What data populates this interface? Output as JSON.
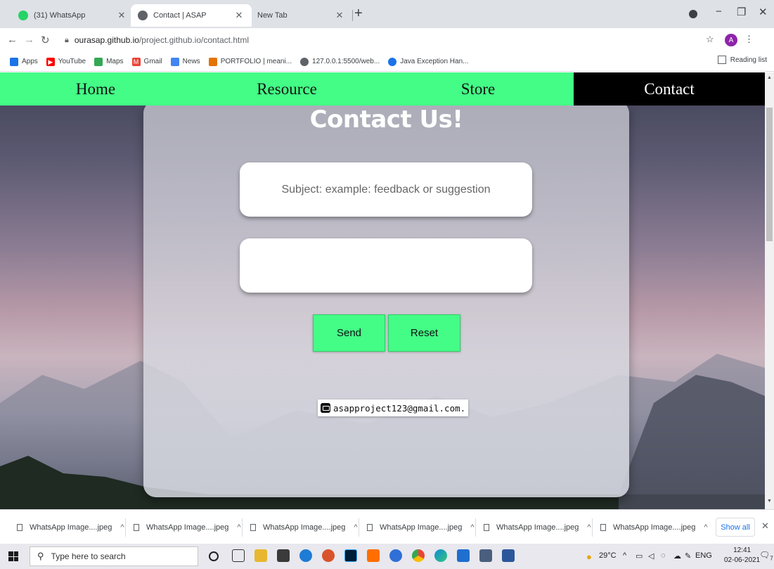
{
  "browser": {
    "tabs": [
      {
        "title": "(31) WhatsApp",
        "favicon_color": "#25d366",
        "favicon_text": "31"
      },
      {
        "title": "Contact | ASAP",
        "favicon_color": "#5f6368"
      },
      {
        "title": "New Tab"
      }
    ],
    "url_host": "ourasap.github.io",
    "url_path": "/project.github.io/contact.html",
    "profile_initial": "A",
    "bookmarks": [
      {
        "label": "Apps",
        "color": "#1a73e8"
      },
      {
        "label": "YouTube",
        "color": "#ff0000"
      },
      {
        "label": "Maps",
        "color": "#34a853"
      },
      {
        "label": "Gmail",
        "color": "#ea4335"
      },
      {
        "label": "News",
        "color": "#4285f4"
      },
      {
        "label": "PORTFOLIO | meani...",
        "color": "#e37400"
      },
      {
        "label": "127.0.0.1:5500/web...",
        "color": "#5f6368"
      },
      {
        "label": "Java Exception Han...",
        "color": "#1a73e8"
      }
    ],
    "reading_list": "Reading list"
  },
  "site": {
    "nav": [
      "Home",
      "Resource",
      "Store",
      "Contact"
    ],
    "nav_active": "Contact",
    "accent_color": "#43fd86",
    "card_title": "Contact Us!",
    "subject_placeholder": "Subject: example: feedback or suggestion",
    "message_value": "",
    "send_label": "Send",
    "reset_label": "Reset",
    "email": "asapproject123@gmail.com."
  },
  "downloads": {
    "items": [
      "WhatsApp Image....jpeg",
      "WhatsApp Image....jpeg",
      "WhatsApp Image....jpeg",
      "WhatsApp Image....jpeg",
      "WhatsApp Image....jpeg",
      "WhatsApp Image....jpeg"
    ],
    "show_all": "Show all"
  },
  "taskbar": {
    "search_placeholder": "Type here to search",
    "weather": "29°C",
    "language": "ENG",
    "time": "12:41",
    "date": "02-06-2021",
    "notification_count": "7"
  }
}
